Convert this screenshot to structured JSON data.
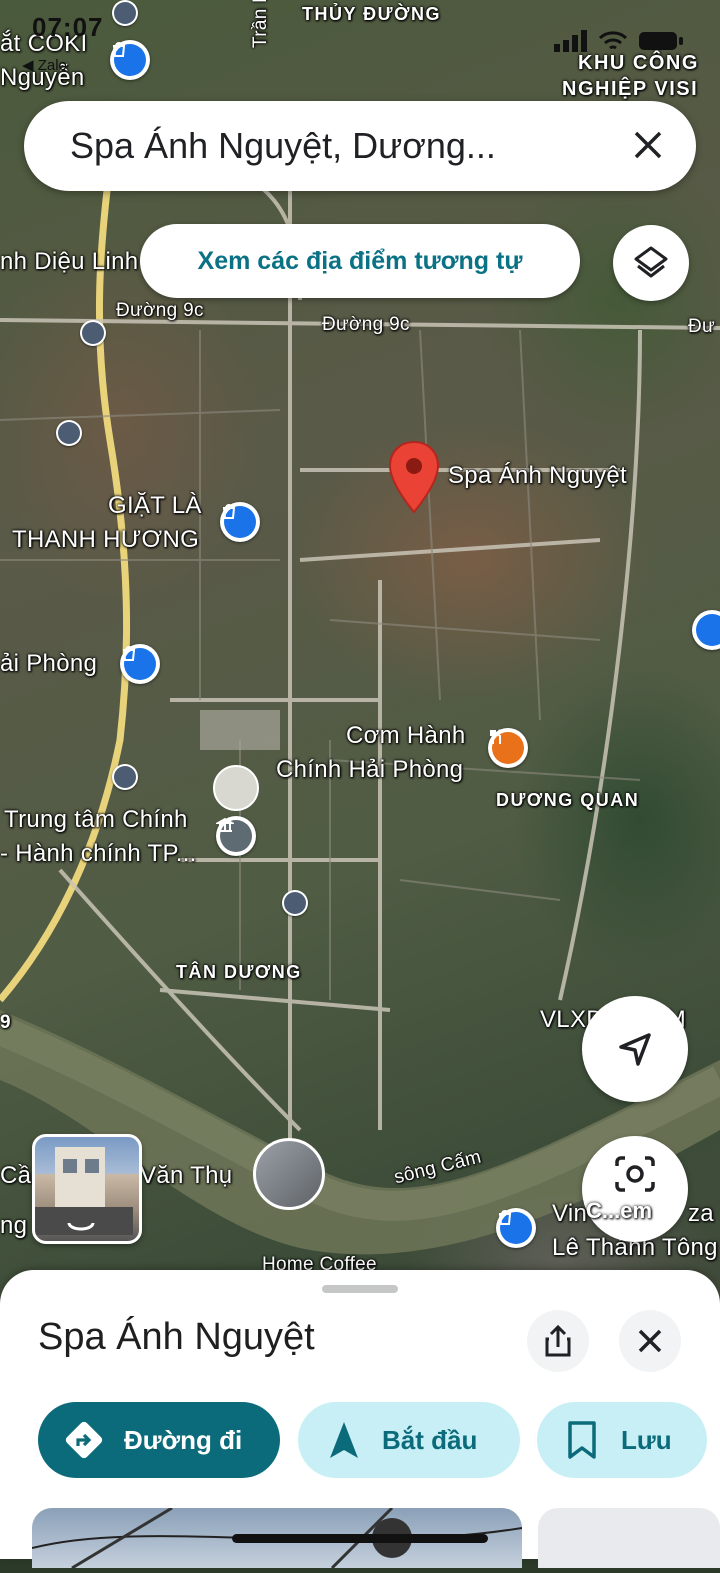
{
  "status": {
    "time": "07:07",
    "back_label": "◀ Zalo"
  },
  "search": {
    "query": "Spa Ánh Nguyệt, Dương..."
  },
  "similar_places_label": "Xem các địa điểm tương tự",
  "map": {
    "labels": {
      "thuy_duong": "THỦY ĐƯỜNG",
      "tran_hung": "Trần Hưng",
      "khu_cong": "KHU CÔNG",
      "nghiep_visi": "NGHIỆP VISI",
      "at_coki": "ắt COKI",
      "nguyen": "Nguyễn",
      "dieu_linh": "nh Diệu Linh",
      "duong9c_a": "Đường 9c",
      "duong9c_b": "Đường 9c",
      "duong_edge": "Đư",
      "spa_name": "Spa Ánh Nguyệt",
      "giat_la_1": "GIẶT LÀ",
      "giat_la_2": "THANH HƯƠNG",
      "hai_phong": "ải Phòng",
      "com_hanh_1": "Cơm Hành",
      "com_hanh_2": "Chính Hải Phòng",
      "duong_quan": "DƯƠNG QUAN",
      "trung_tam_1": "Trung tâm Chính",
      "trung_tam_2": "- Hành chính TP...",
      "tan_duong": "TÂN DƯƠNG",
      "vlx": "VLXD... NAM",
      "ca": "Cầ",
      "ng": "ng",
      "van_thu": "Văn Thụ",
      "song_cam": "sông Cấm",
      "vin_1": "Vin",
      "vin_2": "Lê Thánh Tông",
      "vin_3": "za",
      "home_coffee": "Home Coffee",
      "route_nine": "9"
    }
  },
  "lens_label": "C...em",
  "sheet": {
    "title": "Spa Ánh Nguyệt",
    "directions_label": "Đường đi",
    "start_label": "Bắt đầu",
    "save_label": "Lưu"
  },
  "colors": {
    "accent": "#0b6b7a",
    "pin_red": "#ea4335",
    "chip_bg": "#c9eff6"
  }
}
